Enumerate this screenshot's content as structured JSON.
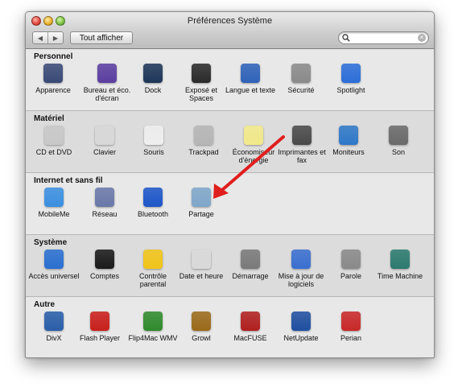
{
  "window": {
    "title": "Préférences Système"
  },
  "toolbar": {
    "back_glyph": "◀",
    "forward_glyph": "▶",
    "show_all_label": "Tout afficher",
    "search_value": "",
    "search_placeholder": "",
    "clear_glyph": "×"
  },
  "sections": [
    {
      "title": "Personnel",
      "items": [
        {
          "label": "Apparence",
          "icon": "appearance-icon",
          "color": "#3a4a76"
        },
        {
          "label": "Bureau et éco. d'écran",
          "icon": "desktop-screensaver-icon",
          "color": "#5b3ea0"
        },
        {
          "label": "Dock",
          "icon": "dock-icon",
          "color": "#1d3658"
        },
        {
          "label": "Exposé et Spaces",
          "icon": "expose-spaces-icon",
          "color": "#2a2a2a"
        },
        {
          "label": "Langue et texte",
          "icon": "language-text-icon",
          "color": "#2f62b8"
        },
        {
          "label": "Sécurité",
          "icon": "security-icon",
          "color": "#8a8a8a"
        },
        {
          "label": "Spotlight",
          "icon": "spotlight-icon",
          "color": "#2c6ed8"
        }
      ]
    },
    {
      "title": "Matériel",
      "items": [
        {
          "label": "CD et DVD",
          "icon": "cd-dvd-icon",
          "color": "#c8c8c8"
        },
        {
          "label": "Clavier",
          "icon": "keyboard-icon",
          "color": "#d8d8d8"
        },
        {
          "label": "Souris",
          "icon": "mouse-icon",
          "color": "#eeeeee"
        },
        {
          "label": "Trackpad",
          "icon": "trackpad-icon",
          "color": "#b5b5b5"
        },
        {
          "label": "Économiseur d'énergie",
          "icon": "energy-saver-icon",
          "color": "#f2e98a"
        },
        {
          "label": "Imprimantes et fax",
          "icon": "printer-icon",
          "color": "#4a4a4a"
        },
        {
          "label": "Moniteurs",
          "icon": "displays-icon",
          "color": "#2f78c8"
        },
        {
          "label": "Son",
          "icon": "sound-icon",
          "color": "#6a6a6a"
        }
      ]
    },
    {
      "title": "Internet et sans fil",
      "items": [
        {
          "label": "MobileMe",
          "icon": "mobileme-icon",
          "color": "#3b8fe0"
        },
        {
          "label": "Réseau",
          "icon": "network-icon",
          "color": "#6a78a8"
        },
        {
          "label": "Bluetooth",
          "icon": "bluetooth-icon",
          "color": "#1d56c8"
        },
        {
          "label": "Partage",
          "icon": "sharing-icon",
          "color": "#7fa6c9"
        }
      ]
    },
    {
      "title": "Système",
      "items": [
        {
          "label": "Accès universel",
          "icon": "universal-access-icon",
          "color": "#2a6fd0"
        },
        {
          "label": "Comptes",
          "icon": "accounts-icon",
          "color": "#1a1a1a"
        },
        {
          "label": "Contrôle parental",
          "icon": "parental-controls-icon",
          "color": "#f0c419"
        },
        {
          "label": "Date et heure",
          "icon": "date-time-icon",
          "color": "#d9d9d9"
        },
        {
          "label": "Démarrage",
          "icon": "startup-disk-icon",
          "color": "#7a7a7a"
        },
        {
          "label": "Mise à jour de logiciels",
          "icon": "software-update-icon",
          "color": "#3a6fd0"
        },
        {
          "label": "Parole",
          "icon": "speech-icon",
          "color": "#8a8a8a"
        },
        {
          "label": "Time Machine",
          "icon": "time-machine-icon",
          "color": "#2c7a6e"
        }
      ]
    },
    {
      "title": "Autre",
      "items": [
        {
          "label": "DivX",
          "icon": "divx-icon",
          "color": "#2a5ea8"
        },
        {
          "label": "Flash Player",
          "icon": "flash-player-icon",
          "color": "#c8201c"
        },
        {
          "label": "Flip4Mac WMV",
          "icon": "flip4mac-icon",
          "color": "#2f8a2c"
        },
        {
          "label": "Growl",
          "icon": "growl-icon",
          "color": "#9a6a1a"
        },
        {
          "label": "MacFUSE",
          "icon": "macfuse-icon",
          "color": "#b02020"
        },
        {
          "label": "NetUpdate",
          "icon": "netupdate-icon",
          "color": "#1f4fa0"
        },
        {
          "label": "Perian",
          "icon": "perian-icon",
          "color": "#c82828"
        }
      ]
    }
  ],
  "annotation": {
    "arrow_color": "#e01e1e"
  }
}
